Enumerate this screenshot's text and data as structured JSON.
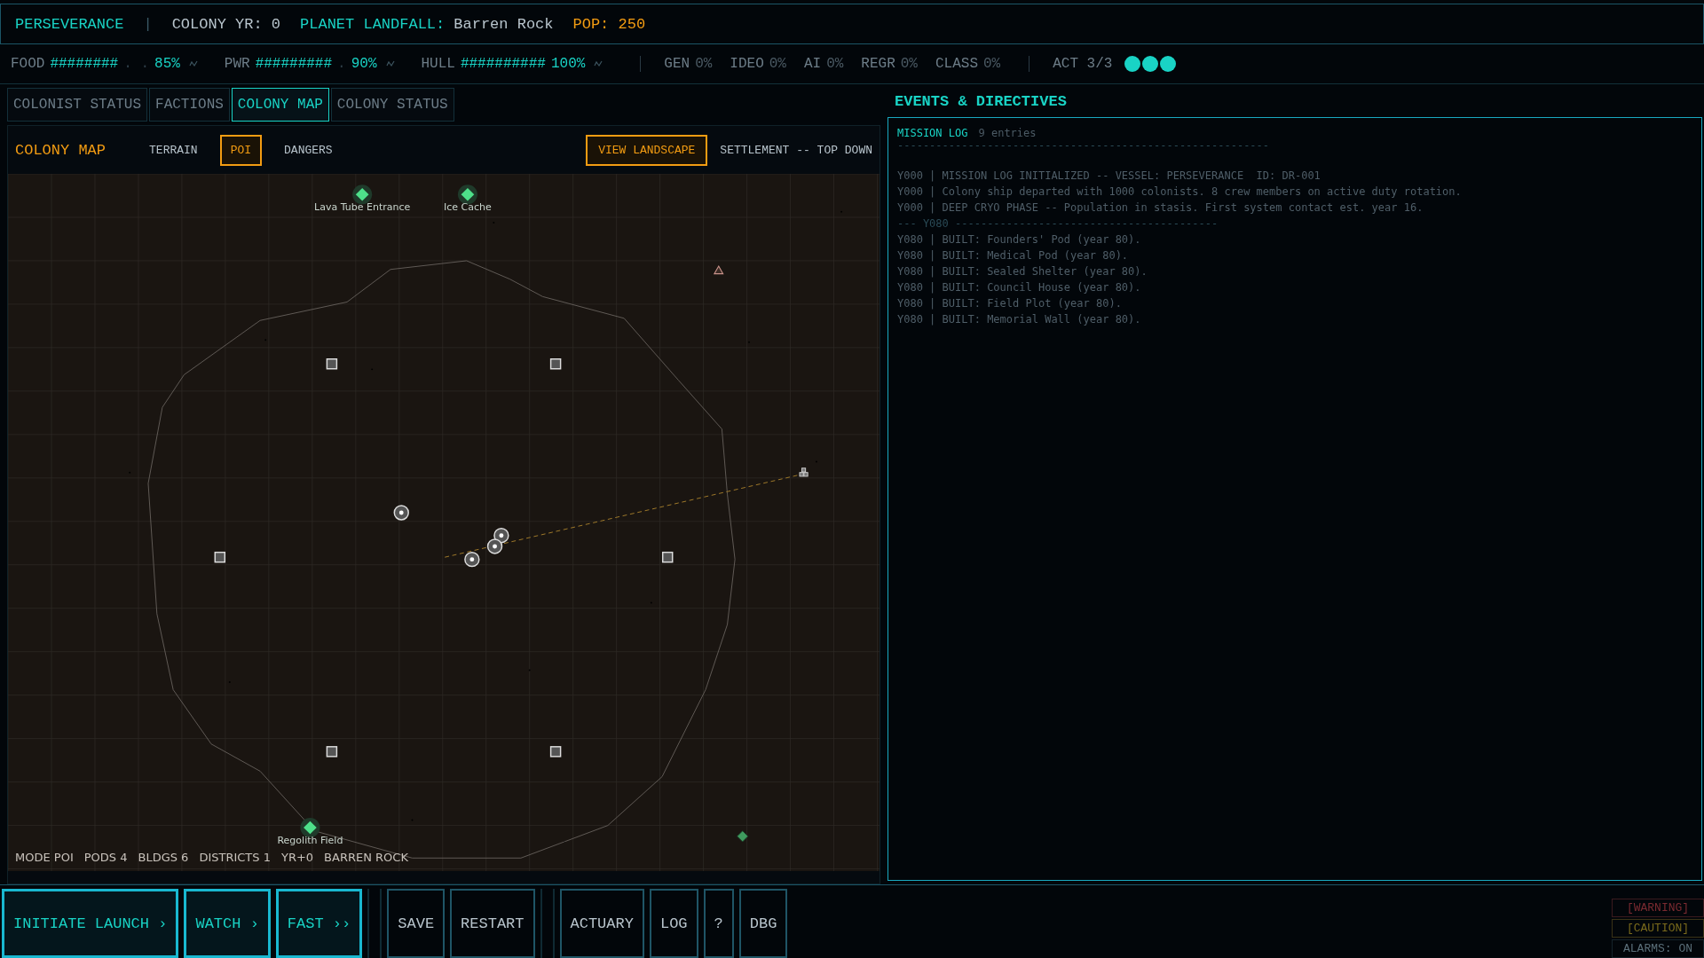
{
  "header": {
    "ship": "PERSEVERANCE",
    "separator": "|",
    "colony_year": "COLONY YR: 0",
    "landfall_label": "PLANET LANDFALL:",
    "landfall_value": "Barren Rock",
    "population": "POP: 250"
  },
  "resources": [
    {
      "label": "FOOD",
      "bar": "########",
      "bar_empty": ". .",
      "value": "85%"
    },
    {
      "label": "PWR",
      "bar": "#########",
      "bar_empty": ".",
      "value": "90%"
    },
    {
      "label": "HULL",
      "bar": "##########",
      "value": "100%"
    }
  ],
  "metrics": [
    {
      "label": "GEN",
      "value": "0%"
    },
    {
      "label": "IDEO",
      "value": "0%"
    },
    {
      "label": "AI",
      "value": "0%"
    },
    {
      "label": "REGR",
      "value": "0%"
    },
    {
      "label": "CLASS",
      "value": "0%"
    }
  ],
  "act": {
    "label": "ACT 3/3",
    "pips": [
      {
        "on": true
      },
      {
        "on": true
      },
      {
        "on": true
      }
    ]
  },
  "tabs": [
    {
      "label": "COLONIST STATUS",
      "selected": false
    },
    {
      "label": "FACTIONS",
      "selected": false
    },
    {
      "label": "COLONY MAP",
      "selected": true
    },
    {
      "label": "COLONY STATUS",
      "selected": false
    }
  ],
  "map": {
    "title": "COLONY MAP",
    "filters": [
      {
        "label": "TERRAIN",
        "selected": false
      },
      {
        "label": "POI",
        "selected": true
      },
      {
        "label": "DANGERS",
        "selected": false
      }
    ],
    "view_button": "VIEW LANDSCAPE",
    "view_mode": "SETTLEMENT -- TOP DOWN",
    "pois": [
      {
        "label": "Lava Tube Entrance"
      },
      {
        "label": "Ice Cache"
      },
      {
        "label": "Regolith Field"
      }
    ],
    "footer": [
      "MODE POI",
      "PODS 4",
      "BLDGS 6",
      "DISTRICTS 1",
      "YR+0",
      "BARREN ROCK"
    ]
  },
  "events": {
    "title": "EVENTS & DIRECTIVES",
    "log_title": "MISSION LOG",
    "count": "9 entries",
    "rule": "----------------------------------------------------------",
    "entries": [
      {
        "kind": "entry",
        "text": "Y000 | MISSION LOG INITIALIZED -- VESSEL: PERSEVERANCE  ID: DR-001"
      },
      {
        "kind": "entry",
        "text": "Y000 | Colony ship departed with 1000 colonists. 8 crew members on active duty rotation."
      },
      {
        "kind": "entry",
        "text": "Y000 | DEEP CRYO PHASE -- Population in stasis. First system contact est. year 16."
      },
      {
        "kind": "divider",
        "text": "--- Y080 -----------------------------------------"
      },
      {
        "kind": "entry",
        "text": "Y080 | BUILT: Founders' Pod (year 80)."
      },
      {
        "kind": "entry",
        "text": "Y080 | BUILT: Medical Pod (year 80)."
      },
      {
        "kind": "entry",
        "text": "Y080 | BUILT: Sealed Shelter (year 80)."
      },
      {
        "kind": "entry",
        "text": "Y080 | BUILT: Council House (year 80)."
      },
      {
        "kind": "entry",
        "text": "Y080 | BUILT: Field Plot (year 80)."
      },
      {
        "kind": "entry",
        "text": "Y080 | BUILT: Memorial Wall (year 80)."
      }
    ]
  },
  "actions": [
    {
      "buttons": [
        {
          "label": "INITIATE LAUNCH ›",
          "kind": "primary"
        },
        {
          "label": "WATCH ›",
          "kind": "primary"
        },
        {
          "label": "FAST ››",
          "kind": "primary"
        }
      ]
    },
    {
      "buttons": [
        {
          "label": "SAVE",
          "kind": "secondary"
        },
        {
          "label": "RESTART",
          "kind": "secondary"
        }
      ]
    },
    {
      "buttons": [
        {
          "label": "ACTUARY",
          "kind": "secondary"
        },
        {
          "label": "LOG",
          "kind": "secondary"
        },
        {
          "label": "?",
          "kind": "secondary"
        },
        {
          "label": "DBG",
          "kind": "secondary"
        }
      ]
    }
  ],
  "alerts": [
    {
      "label": "[WARNING]",
      "kind": "warning"
    },
    {
      "label": "[CAUTION]",
      "kind": "caution"
    },
    {
      "label": "ALARMS: ON",
      "kind": "status"
    }
  ]
}
